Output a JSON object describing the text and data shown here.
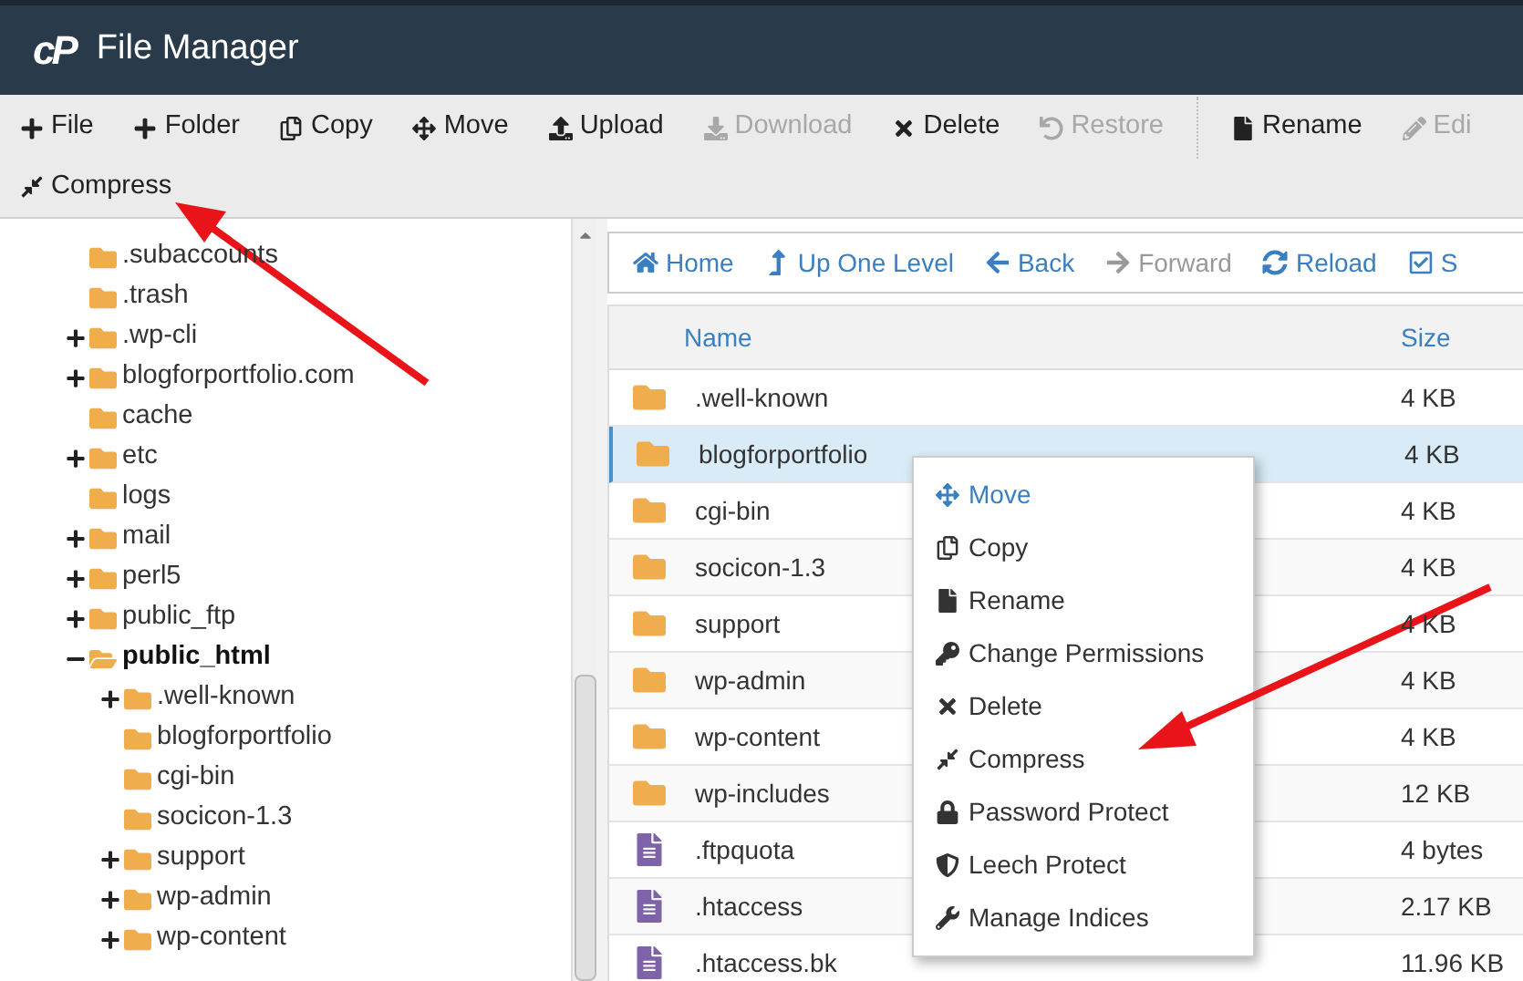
{
  "header": {
    "logo": "cP",
    "title": "File Manager"
  },
  "toolbar": [
    {
      "label": "File",
      "disabled": false
    },
    {
      "label": "Folder",
      "disabled": false
    },
    {
      "label": "Copy",
      "disabled": false
    },
    {
      "label": "Move",
      "disabled": false
    },
    {
      "label": "Upload",
      "disabled": false
    },
    {
      "label": "Download",
      "disabled": true
    },
    {
      "label": "Delete",
      "disabled": false
    },
    {
      "label": "Restore",
      "disabled": true
    },
    {
      "label": "Rename",
      "disabled": false
    },
    {
      "label": "Edi",
      "disabled": true
    },
    {
      "label": "Compress",
      "disabled": false
    }
  ],
  "tree": [
    {
      "name": ".subaccounts",
      "kind": "leaf",
      "selected": false
    },
    {
      "name": ".trash",
      "kind": "leaf",
      "selected": false
    },
    {
      "name": ".wp-cli",
      "kind": "collapsed",
      "selected": false
    },
    {
      "name": "blogforportfolio.com",
      "kind": "collapsed",
      "selected": false
    },
    {
      "name": "cache",
      "kind": "leaf",
      "selected": false
    },
    {
      "name": "etc",
      "kind": "collapsed",
      "selected": false
    },
    {
      "name": "logs",
      "kind": "leaf",
      "selected": false
    },
    {
      "name": "mail",
      "kind": "collapsed",
      "selected": false
    },
    {
      "name": "perl5",
      "kind": "collapsed",
      "selected": false
    },
    {
      "name": "public_ftp",
      "kind": "collapsed",
      "selected": false
    },
    {
      "name": "public_html",
      "kind": "expanded",
      "selected": true,
      "children": [
        {
          "name": ".well-known",
          "kind": "collapsed",
          "selected": false
        },
        {
          "name": "blogforportfolio",
          "kind": "leaf",
          "selected": false
        },
        {
          "name": "cgi-bin",
          "kind": "leaf",
          "selected": false
        },
        {
          "name": "socicon-1.3",
          "kind": "leaf",
          "selected": false
        },
        {
          "name": "support",
          "kind": "collapsed",
          "selected": false
        },
        {
          "name": "wp-admin",
          "kind": "collapsed",
          "selected": false
        },
        {
          "name": "wp-content",
          "kind": "collapsed",
          "selected": false
        }
      ]
    }
  ],
  "nav": [
    {
      "label": "Home",
      "disabled": false
    },
    {
      "label": "Up One Level",
      "disabled": false
    },
    {
      "label": "Back",
      "disabled": false
    },
    {
      "label": "Forward",
      "disabled": true
    },
    {
      "label": "Reload",
      "disabled": false
    },
    {
      "label": "S",
      "disabled": false
    }
  ],
  "table": {
    "columns": [
      "Name",
      "Size"
    ],
    "rows": [
      {
        "name": ".well-known",
        "size": "4 KB",
        "kind": "folder",
        "selected": false
      },
      {
        "name": "blogforportfolio",
        "size": "4 KB",
        "kind": "folder",
        "selected": true
      },
      {
        "name": "cgi-bin",
        "size": "4 KB",
        "kind": "folder",
        "selected": false
      },
      {
        "name": "socicon-1.3",
        "size": "4 KB",
        "kind": "folder",
        "selected": false
      },
      {
        "name": "support",
        "size": "4 KB",
        "kind": "folder",
        "selected": false
      },
      {
        "name": "wp-admin",
        "size": "4 KB",
        "kind": "folder",
        "selected": false
      },
      {
        "name": "wp-content",
        "size": "4 KB",
        "kind": "folder",
        "selected": false
      },
      {
        "name": "wp-includes",
        "size": "12 KB",
        "kind": "folder",
        "selected": false
      },
      {
        "name": ".ftpquota",
        "size": "4 bytes",
        "kind": "file",
        "selected": false
      },
      {
        "name": ".htaccess",
        "size": "2.17 KB",
        "kind": "file",
        "selected": false
      },
      {
        "name": ".htaccess.bk",
        "size": "11.96 KB",
        "kind": "file",
        "selected": false
      }
    ]
  },
  "context_menu": [
    "Move",
    "Copy",
    "Rename",
    "Change Permissions",
    "Delete",
    "Compress",
    "Password Protect",
    "Leech Protect",
    "Manage Indices"
  ]
}
